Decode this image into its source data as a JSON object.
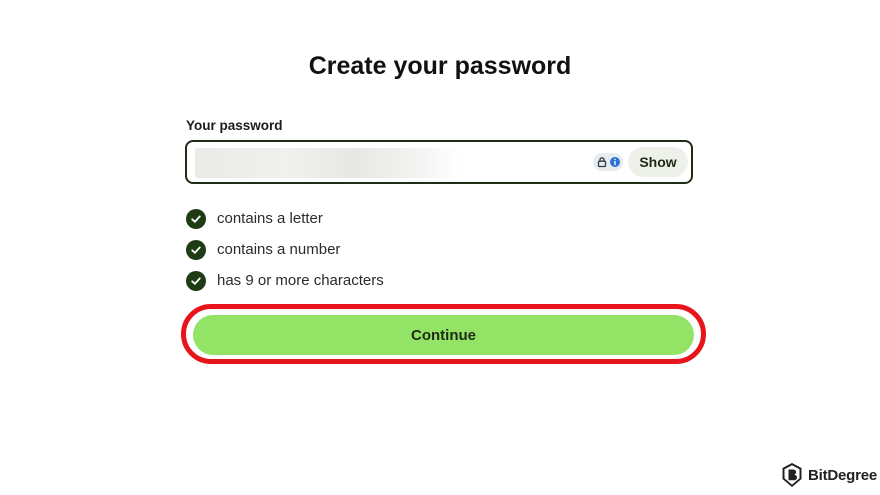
{
  "page": {
    "title": "Create your password"
  },
  "password": {
    "label": "Your password",
    "value": "",
    "masked": true,
    "password_manager_icon": "lock-info-icon",
    "show_label": "Show"
  },
  "requirements": [
    {
      "text": "contains a letter",
      "met": true,
      "icon": "check-circle-icon"
    },
    {
      "text": "contains a number",
      "met": true,
      "icon": "check-circle-icon"
    },
    {
      "text": "has 9 or more characters",
      "met": true,
      "icon": "check-circle-icon"
    }
  ],
  "continue": {
    "label": "Continue",
    "highlighted": true
  },
  "watermark": {
    "text": "BitDegree"
  },
  "colors": {
    "accent_green": "#93e466",
    "dark_green": "#1f3b14",
    "highlight_red": "#e8141b"
  }
}
